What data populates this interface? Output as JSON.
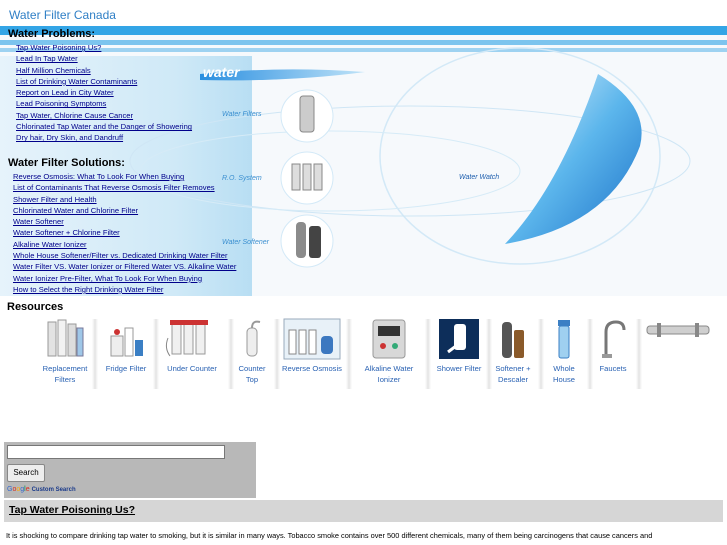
{
  "site_title": "Water Filter Canada",
  "hero": {
    "logo_text": "water",
    "labels": {
      "filters": "Water Filters",
      "ro": "R.O. System",
      "softener": "Water Softener",
      "watch": "Water Watch"
    }
  },
  "water_problems": {
    "heading": "Water Problems:",
    "links": [
      "Tap Water Poisoning Us?",
      "Lead In Tap Water",
      "Half Million Chemicals",
      "List of Drinking Water Contaminants",
      "Report on Lead in City Water",
      "Lead Poisoning Symptoms",
      "Tap Water, Chlorine Cause Cancer",
      "Chlorinated Tap Water and the Danger of Showering",
      "Dry hair, Dry Skin, and Dandruff"
    ]
  },
  "water_solutions": {
    "heading": "Water Filter Solutions:",
    "links": [
      "Reverse Osmosis: What To Look For When Buying",
      "List of Contaminants That Reverse Osmosis Filter Removes",
      "Shower Filter and Health",
      "Chlorinated Water and Chlorine Filter",
      "Water Softener",
      "Water Softener + Chlorine Filter",
      "Alkaline Water Ionizer",
      "Whole House Softener/Filter vs. Dedicated Drinking Water Filter",
      "Water Filter VS. Water Ionizer    or     Filtered Water VS. Alkaline Water",
      "Water Ionizer Pre-Filter, What To Look For When Buying",
      "How to Select the Right Drinking Water Filter"
    ]
  },
  "resources": {
    "heading": "Resources",
    "items": [
      {
        "label": "Replacement Filters",
        "icon": "cartridges-icon"
      },
      {
        "label": "Fridge Filter",
        "icon": "fridge-filter-icon"
      },
      {
        "label": "Under Counter",
        "icon": "under-counter-icon"
      },
      {
        "label": "Counter Top",
        "icon": "counter-top-icon"
      },
      {
        "label": "Reverse Osmosis",
        "icon": "reverse-osmosis-icon"
      },
      {
        "label": "Alkaline Water Ionizer",
        "icon": "ionizer-icon"
      },
      {
        "label": "Shower Filter",
        "icon": "shower-filter-icon"
      },
      {
        "label": "Softener + Descaler",
        "icon": "softener-icon"
      },
      {
        "label": "Whole House",
        "icon": "whole-house-icon"
      },
      {
        "label": "Faucets",
        "icon": "faucet-icon"
      },
      {
        "label": "",
        "icon": "uv-sterilizer-icon"
      }
    ]
  },
  "search": {
    "button_label": "Search",
    "google": "Google",
    "custom": "Custom Search"
  },
  "article": {
    "title": "Tap Water Poisoning Us?",
    "text": "It is shocking to compare drinking tap water to smoking, but it is similar in many ways.  Tobacco smoke contains over 500 different chemicals, many of them being carcinogens that cause cancers and"
  },
  "colors": {
    "title_blue": "#2f7fc6",
    "band_blue": "#33a5e6",
    "link": "#00008b",
    "resource_label": "#2a62b3"
  }
}
